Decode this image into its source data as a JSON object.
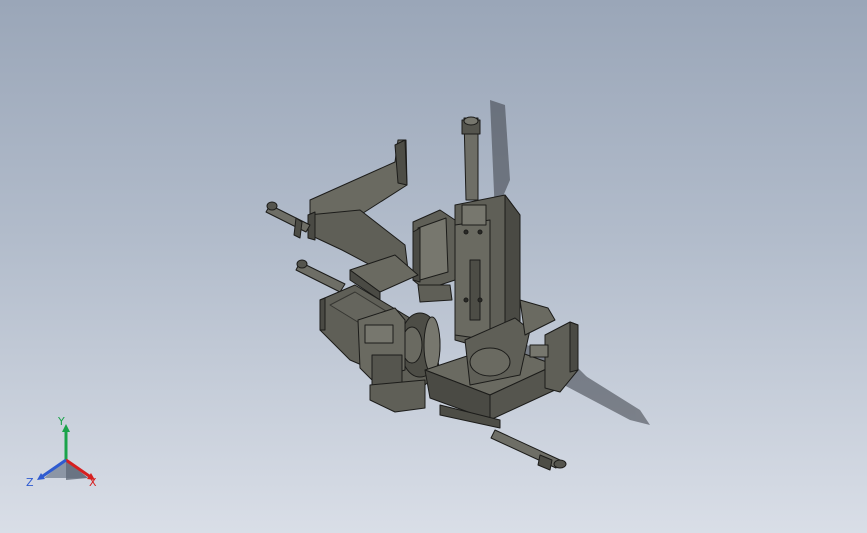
{
  "viewport": {
    "background_top": "#9aa6b8",
    "background_bottom": "#d9dee7",
    "model_color": "#5f5f57",
    "model_shade": "#4a4a44",
    "model_light": "#77776e",
    "edge_color": "#1c1c1a"
  },
  "triad": {
    "axes": [
      {
        "label": "Y",
        "color": "#1aa34a"
      },
      {
        "label": "X",
        "color": "#d62020"
      },
      {
        "label": "Z",
        "color": "#2f5bd0"
      }
    ]
  }
}
